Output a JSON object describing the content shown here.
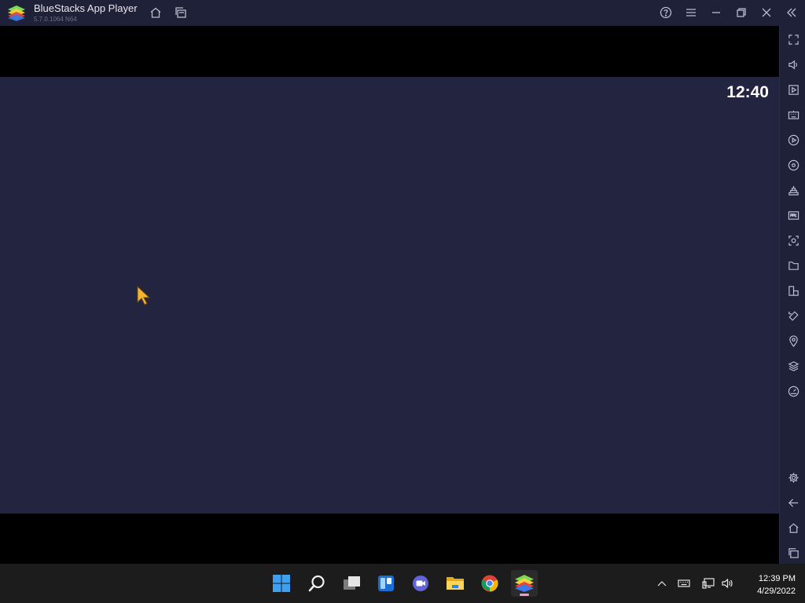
{
  "window": {
    "title": "BlueStacks App Player",
    "version": "5.7.0.1064  N64"
  },
  "titlebar_icons": [
    "home-icon",
    "multi-instance-icon",
    "help-icon",
    "menu-icon",
    "minimize-icon",
    "restore-icon",
    "close-icon",
    "collapse-sidebar-icon"
  ],
  "android": {
    "clock": "12:40"
  },
  "sidebar": {
    "items": [
      "fullscreen-icon",
      "volume-icon",
      "media-manager-icon",
      "keyboard-controls-icon",
      "macro-recorder-icon",
      "record-icon",
      "game-controls-icon",
      "install-apk-icon",
      "screenshot-icon",
      "folder-icon",
      "multi-instance-manager-icon",
      "rotate-icon",
      "location-icon",
      "layers-icon",
      "eco-mode-icon",
      "settings-icon",
      "back-icon",
      "android-home-icon",
      "recent-apps-icon"
    ]
  },
  "taskbar": {
    "apps": [
      "windows-start-icon",
      "search-icon",
      "task-view-icon",
      "widgets-icon",
      "teams-chat-icon",
      "file-explorer-icon",
      "chrome-icon",
      "bluestacks-icon"
    ],
    "time": "12:39 PM",
    "date": "4/29/2022"
  },
  "colors": {
    "titlebar_bg": "#1e2137",
    "screen_bg": "#222440",
    "letterbox": "#000000",
    "taskbar_bg": "#1c1c1c",
    "cursor": "#f5b52e"
  }
}
